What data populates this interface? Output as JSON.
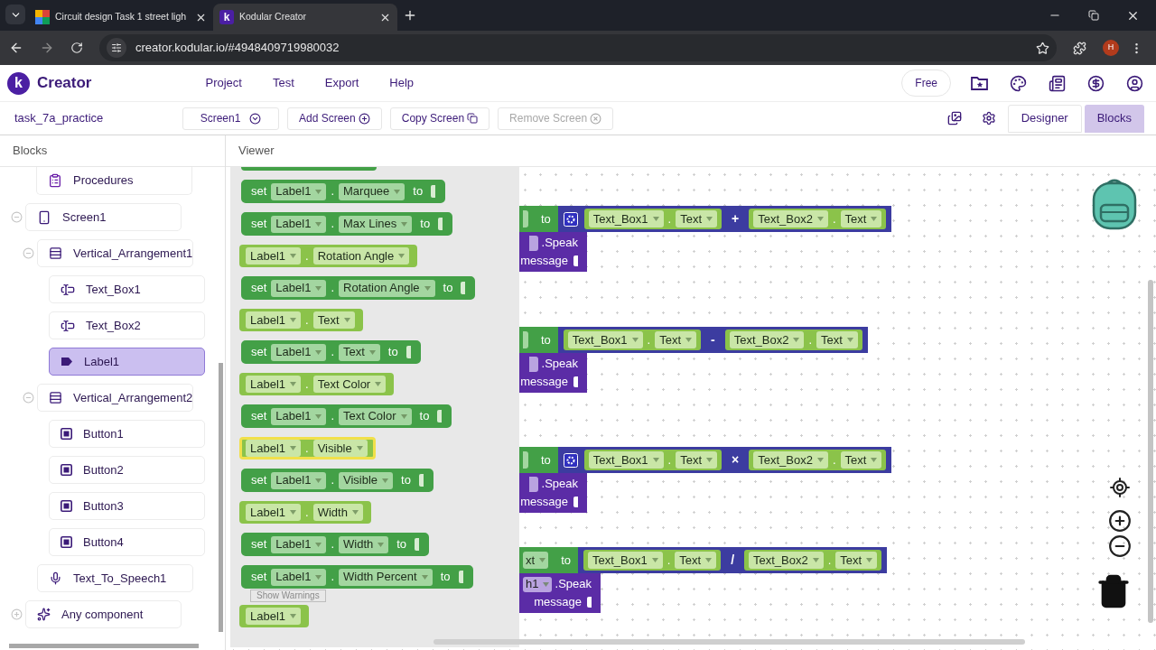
{
  "browser": {
    "tabs": [
      {
        "title": "Circuit design Task 1 street ligh",
        "selected": false
      },
      {
        "title": "Kodular Creator",
        "icon_letter": "k",
        "selected": true
      }
    ],
    "url": "creator.kodular.io/#4948409719980032",
    "profile_initial": "H"
  },
  "app": {
    "logo": "k",
    "brand": "Creator",
    "menu": [
      "Project",
      "Test",
      "Export",
      "Help"
    ],
    "plan": "Free"
  },
  "toolbar": {
    "project": "task_7a_practice",
    "screen": "Screen1",
    "buttons": [
      {
        "label": "Add Screen",
        "kind": "add",
        "disabled": false
      },
      {
        "label": "Copy Screen",
        "kind": "copy",
        "disabled": false
      },
      {
        "label": "Remove Screen",
        "kind": "remove",
        "disabled": true
      }
    ],
    "views": [
      {
        "label": "Designer",
        "selected": false
      },
      {
        "label": "Blocks",
        "selected": true
      }
    ]
  },
  "blocks_panel": {
    "title": "Blocks",
    "builtin": [
      {
        "label": "Procedures",
        "kind": "procedures"
      }
    ],
    "tree": [
      {
        "label": "Screen1",
        "kind": "screen",
        "expanded": true,
        "selected": false,
        "children": [
          {
            "label": "Vertical_Arrangement1",
            "kind": "arrangement",
            "expanded": true,
            "selected": false,
            "children": [
              {
                "label": "Text_Box1",
                "kind": "textbox",
                "selected": false
              },
              {
                "label": "Text_Box2",
                "kind": "textbox",
                "selected": false
              },
              {
                "label": "Label1",
                "kind": "label",
                "selected": true
              }
            ]
          },
          {
            "label": "Vertical_Arrangement2",
            "kind": "arrangement",
            "expanded": true,
            "selected": false,
            "children": [
              {
                "label": "Button1",
                "kind": "button",
                "selected": false
              },
              {
                "label": "Button2",
                "kind": "button",
                "selected": false
              },
              {
                "label": "Button3",
                "kind": "button",
                "selected": false
              },
              {
                "label": "Button4",
                "kind": "button",
                "selected": false
              }
            ]
          },
          {
            "label": "Text_To_Speech1",
            "kind": "speech",
            "selected": false
          }
        ]
      },
      {
        "label": "Any component",
        "kind": "any",
        "expanded": false,
        "selected": false
      }
    ]
  },
  "viewer": {
    "title": "Viewer",
    "flyout": {
      "show_warnings": "Show Warnings",
      "blocks": [
        {
          "kind": "partial"
        },
        {
          "kind": "setter",
          "set": "set",
          "component": "Label1",
          "dot": ".",
          "property": "Marquee",
          "to": "to",
          "selected": false
        },
        {
          "kind": "setter",
          "set": "set",
          "component": "Label1",
          "dot": ".",
          "property": "Max Lines",
          "to": "to",
          "selected": false
        },
        {
          "kind": "getter",
          "component": "Label1",
          "dot": ".",
          "property": "Rotation Angle",
          "selected": false
        },
        {
          "kind": "setter",
          "set": "set",
          "component": "Label1",
          "dot": ".",
          "property": "Rotation Angle",
          "to": "to",
          "selected": false
        },
        {
          "kind": "getter",
          "component": "Label1",
          "dot": ".",
          "property": "Text",
          "selected": false
        },
        {
          "kind": "setter",
          "set": "set",
          "component": "Label1",
          "dot": ".",
          "property": "Text",
          "to": "to",
          "selected": false
        },
        {
          "kind": "getter",
          "component": "Label1",
          "dot": ".",
          "property": "Text Color",
          "selected": false
        },
        {
          "kind": "setter",
          "set": "set",
          "component": "Label1",
          "dot": ".",
          "property": "Text Color",
          "to": "to",
          "selected": false
        },
        {
          "kind": "getter",
          "component": "Label1",
          "dot": ".",
          "property": "Visible",
          "selected": true
        },
        {
          "kind": "setter",
          "set": "set",
          "component": "Label1",
          "dot": ".",
          "property": "Visible",
          "to": "to",
          "selected": false
        },
        {
          "kind": "getter",
          "component": "Label1",
          "dot": ".",
          "property": "Width",
          "selected": false
        },
        {
          "kind": "setter",
          "set": "set",
          "component": "Label1",
          "dot": ".",
          "property": "Width",
          "to": "to",
          "selected": false
        },
        {
          "kind": "setter",
          "set": "set",
          "component": "Label1",
          "dot": ".",
          "property": "Width Percent",
          "to": "to",
          "selected": false
        },
        {
          "kind": "getter",
          "component": "Label1",
          "selected": false
        }
      ]
    },
    "groups": [
      {
        "to": "to",
        "mutator": true,
        "left": {
          "component": "Text_Box1",
          "dot": ".",
          "property": "Text"
        },
        "operator": "+",
        "right": {
          "component": "Text_Box2",
          "dot": ".",
          "property": "Text"
        },
        "speak": ".Speak",
        "message": "message"
      },
      {
        "to": "to",
        "mutator": false,
        "left": {
          "component": "Text_Box1",
          "dot": ".",
          "property": "Text"
        },
        "operator": "-",
        "right": {
          "component": "Text_Box2",
          "dot": ".",
          "property": "Text"
        },
        "speak": ".Speak",
        "message": "message"
      },
      {
        "to": "to",
        "mutator": true,
        "left": {
          "component": "Text_Box1",
          "dot": ".",
          "property": "Text"
        },
        "operator": "×",
        "right": {
          "component": "Text_Box2",
          "dot": ".",
          "property": "Text"
        },
        "speak": ".Speak",
        "message": "message"
      },
      {
        "setter_fragment": "xt",
        "to": "to",
        "mutator": false,
        "left": {
          "component": "Text_Box1",
          "dot": ".",
          "property": "Text"
        },
        "operator": "/",
        "right": {
          "component": "Text_Box2",
          "dot": ".",
          "property": "Text"
        },
        "call_fragment": "h1",
        "speak": ".Speak",
        "message": "message"
      }
    ]
  }
}
